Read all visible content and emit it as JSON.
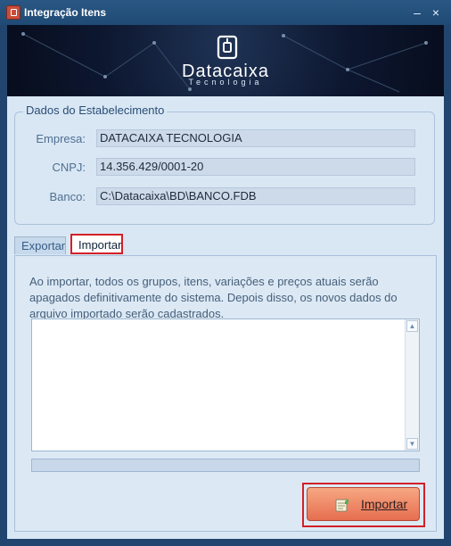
{
  "window": {
    "title": "Integração Itens",
    "controls": {
      "minimize": "–",
      "close": "×"
    }
  },
  "brand": {
    "name": "Datacaixa",
    "subtitle": "Tecnologia"
  },
  "establishment": {
    "title": "Dados do Estabelecimento",
    "fields": [
      {
        "label": "Empresa:",
        "value": "DATACAIXA TECNOLOGIA"
      },
      {
        "label": "CNPJ:",
        "value": "14.356.429/0001-20"
      },
      {
        "label": "Banco:",
        "value": "C:\\Datacaixa\\BD\\BANCO.FDB"
      }
    ]
  },
  "tabs": [
    {
      "label": "Exportar",
      "selected": false
    },
    {
      "label": "Importar",
      "selected": true
    }
  ],
  "import": {
    "description": "Ao importar, todos os grupos, itens, variações e preços atuais serão apagados definitivamente do sistema. Depois disso, os novos dados do arquivo importado serão cadastrados.",
    "textarea_value": "",
    "progress_percent": 0,
    "button_label": "Importar"
  },
  "colors": {
    "window": "#21456e",
    "content": "#d9e7f4",
    "highlight": "#d32027",
    "button": "#ec7d5c"
  },
  "icons": {
    "app": "app-icon",
    "logo": "datacaixa-logo",
    "import": "import-icon",
    "scroll_up": "scroll-up-icon",
    "scroll_down": "scroll-down-icon"
  }
}
